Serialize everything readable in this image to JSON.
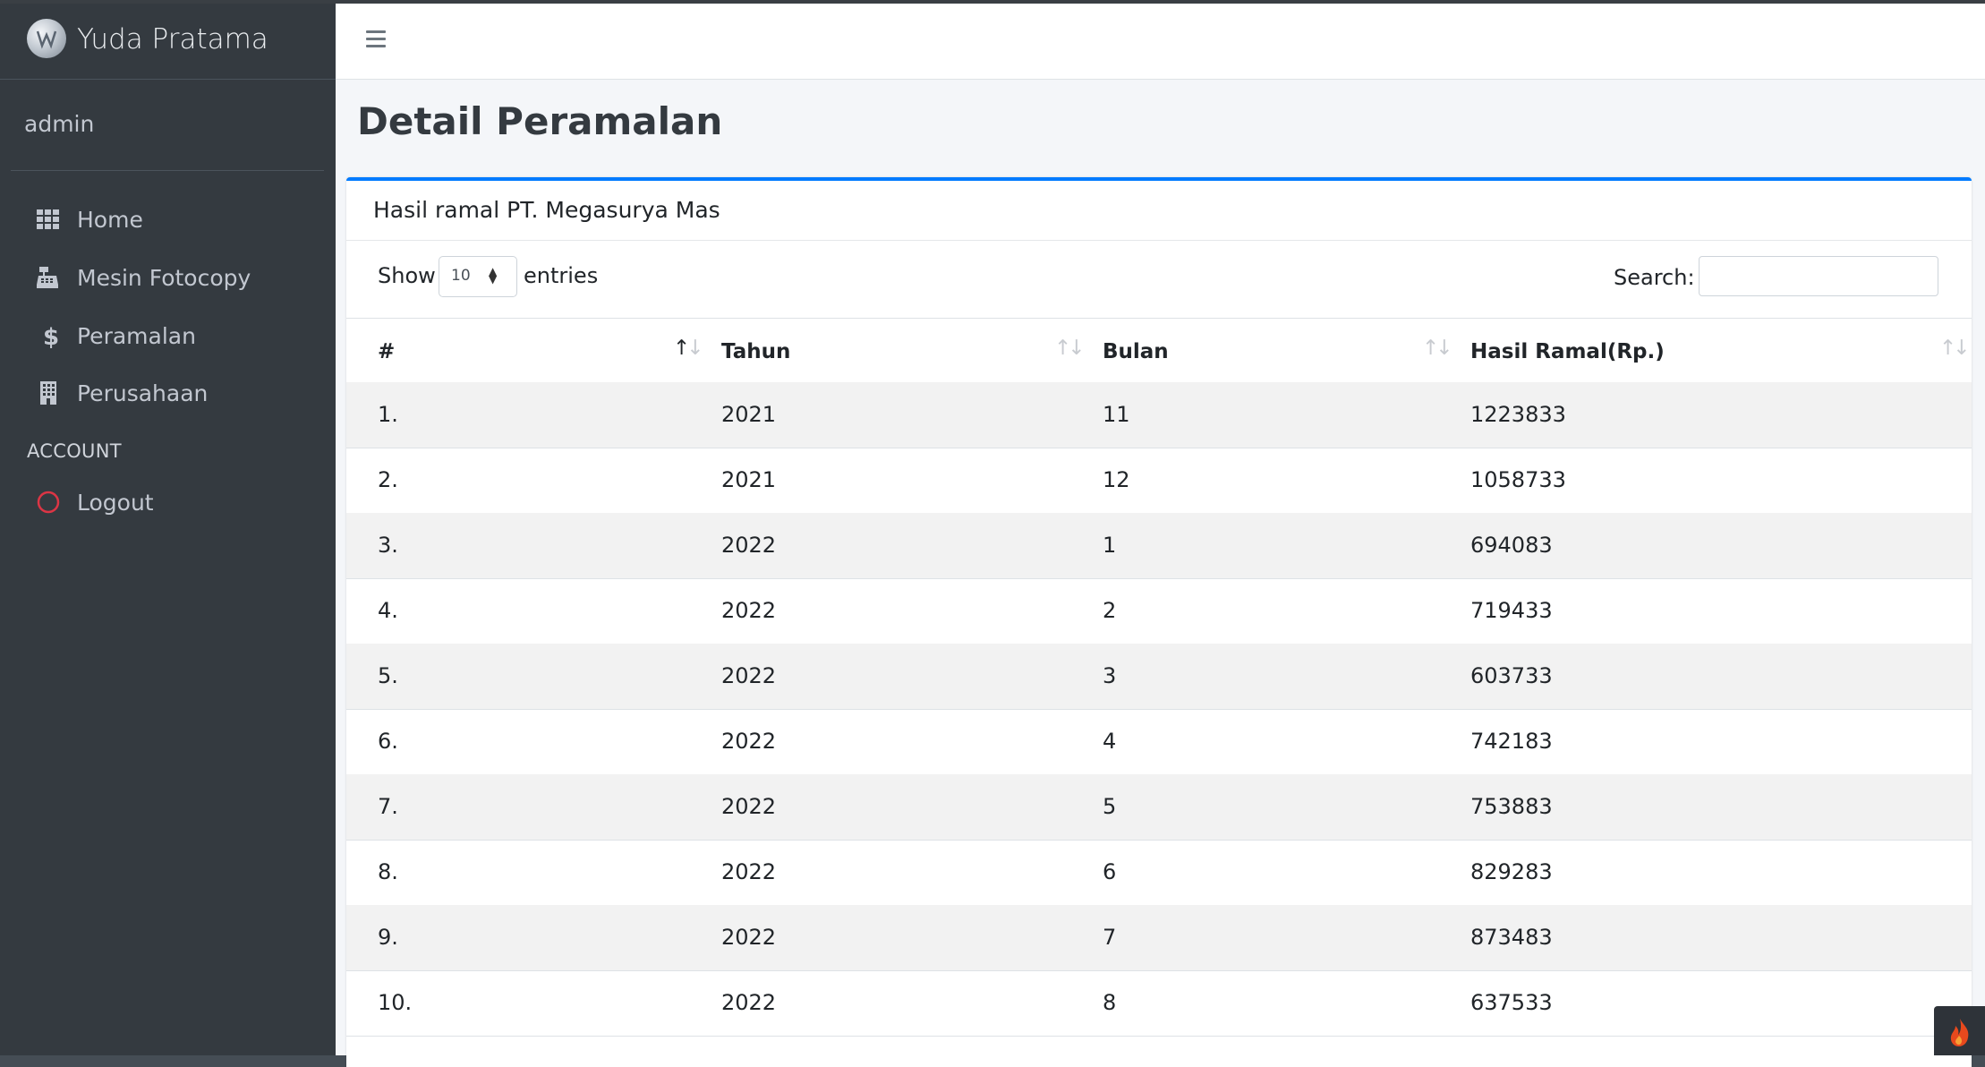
{
  "brand": {
    "name": "Yuda Pratama"
  },
  "user": {
    "name": "admin"
  },
  "sidebar": {
    "items": [
      {
        "label": "Home",
        "icon": "grid-icon"
      },
      {
        "label": "Mesin Fotocopy",
        "icon": "cash-register-icon"
      },
      {
        "label": "Peramalan",
        "icon": "dollar-icon"
      },
      {
        "label": "Perusahaan",
        "icon": "building-icon"
      }
    ],
    "account_header": "ACCOUNT",
    "logout": {
      "label": "Logout",
      "icon": "circle-icon",
      "color": "#dc3545"
    }
  },
  "page": {
    "title": "Detail Peramalan"
  },
  "card": {
    "title": "Hasil ramal PT. Megasurya Mas"
  },
  "datatable": {
    "show_label": "Show",
    "length_value": "10",
    "entries_label": "entries",
    "search_label": "Search:",
    "search_value": "",
    "columns": [
      "#",
      "Tahun",
      "Bulan",
      "Hasil Ramal(Rp.)"
    ],
    "rows": [
      [
        "1.",
        "2021",
        "11",
        "1223833"
      ],
      [
        "2.",
        "2021",
        "12",
        "1058733"
      ],
      [
        "3.",
        "2022",
        "1",
        "694083"
      ],
      [
        "4.",
        "2022",
        "2",
        "719433"
      ],
      [
        "5.",
        "2022",
        "3",
        "603733"
      ],
      [
        "6.",
        "2022",
        "4",
        "742183"
      ],
      [
        "7.",
        "2022",
        "5",
        "753883"
      ],
      [
        "8.",
        "2022",
        "6",
        "829283"
      ],
      [
        "9.",
        "2022",
        "7",
        "873483"
      ],
      [
        "10.",
        "2022",
        "8",
        "637533"
      ]
    ]
  },
  "colors": {
    "accent": "#007bff",
    "sidebar": "#343a40",
    "content_bg": "#f4f6f9",
    "stripe": "#f2f2f2"
  }
}
